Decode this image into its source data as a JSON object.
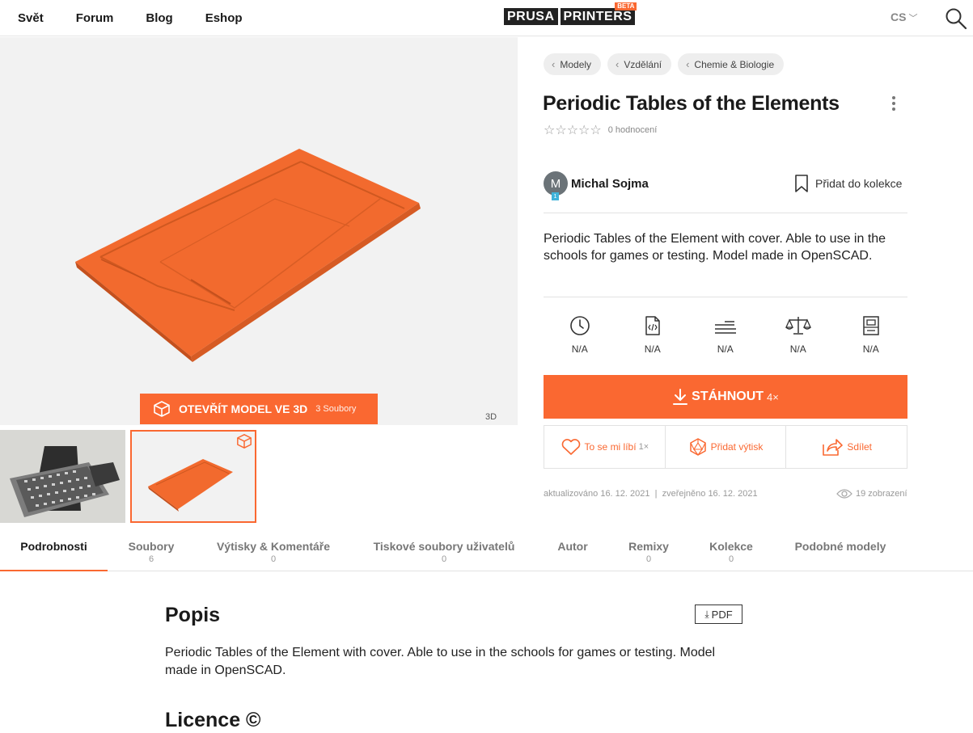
{
  "nav": {
    "items": [
      "Svět",
      "Forum",
      "Blog",
      "Eshop"
    ],
    "logo_left": "PRUSA",
    "logo_right": "PRINTERS",
    "logo_badge": "BETA",
    "language": "CS"
  },
  "viewer": {
    "open_label": "OTEVŘÍT MODEL VE 3D",
    "files_count": "3 Soubory",
    "mode_badge": "3D"
  },
  "breadcrumbs": [
    "Modely",
    "Vzdělání",
    "Chemie & Biologie"
  ],
  "model": {
    "title": "Periodic Tables of the Elements",
    "rating_count": "0 hodnocení",
    "author": "Michal Sojma",
    "author_initial": "M",
    "author_level": "1",
    "add_collection": "Přidat do kolekce",
    "summary": "Periodic Tables of the Element with cover. Able to use in the schools for games or testing. Model made in OpenSCAD."
  },
  "params": [
    {
      "icon": "clock-icon",
      "value": "N/A"
    },
    {
      "icon": "code-file-icon",
      "value": "N/A"
    },
    {
      "icon": "layers-icon",
      "value": "N/A"
    },
    {
      "icon": "scale-icon",
      "value": "N/A"
    },
    {
      "icon": "printer-icon",
      "value": "N/A"
    }
  ],
  "download": {
    "label": "STÁHNOUT",
    "count": "4×"
  },
  "actions": {
    "like_label": "To se mi líbí",
    "like_count": "1×",
    "make_label": "Přidat výtisk",
    "share_label": "Sdílet"
  },
  "meta": {
    "dates": "aktualizováno 16. 12. 2021  |  zveřejněno 16. 12. 2021",
    "views": "19 zobrazení"
  },
  "tabs": [
    {
      "label": "Podrobnosti",
      "count": ""
    },
    {
      "label": "Soubory",
      "count": "6"
    },
    {
      "label": "Výtisky & Komentáře",
      "count": "0"
    },
    {
      "label": "Tiskové soubory uživatelů",
      "count": "0"
    },
    {
      "label": "Autor",
      "count": ""
    },
    {
      "label": "Remixy",
      "count": "0"
    },
    {
      "label": "Kolekce",
      "count": "0"
    },
    {
      "label": "Podobné modely",
      "count": ""
    }
  ],
  "content": {
    "description_heading": "Popis",
    "pdf_label": "PDF",
    "description": "Periodic Tables of the Element with cover. Able to use in the schools for games or testing. Model made in OpenSCAD.",
    "license_heading": "Licence ©"
  },
  "colors": {
    "accent": "#fa6831",
    "text": "#1a1a1a",
    "muted": "#999999"
  }
}
